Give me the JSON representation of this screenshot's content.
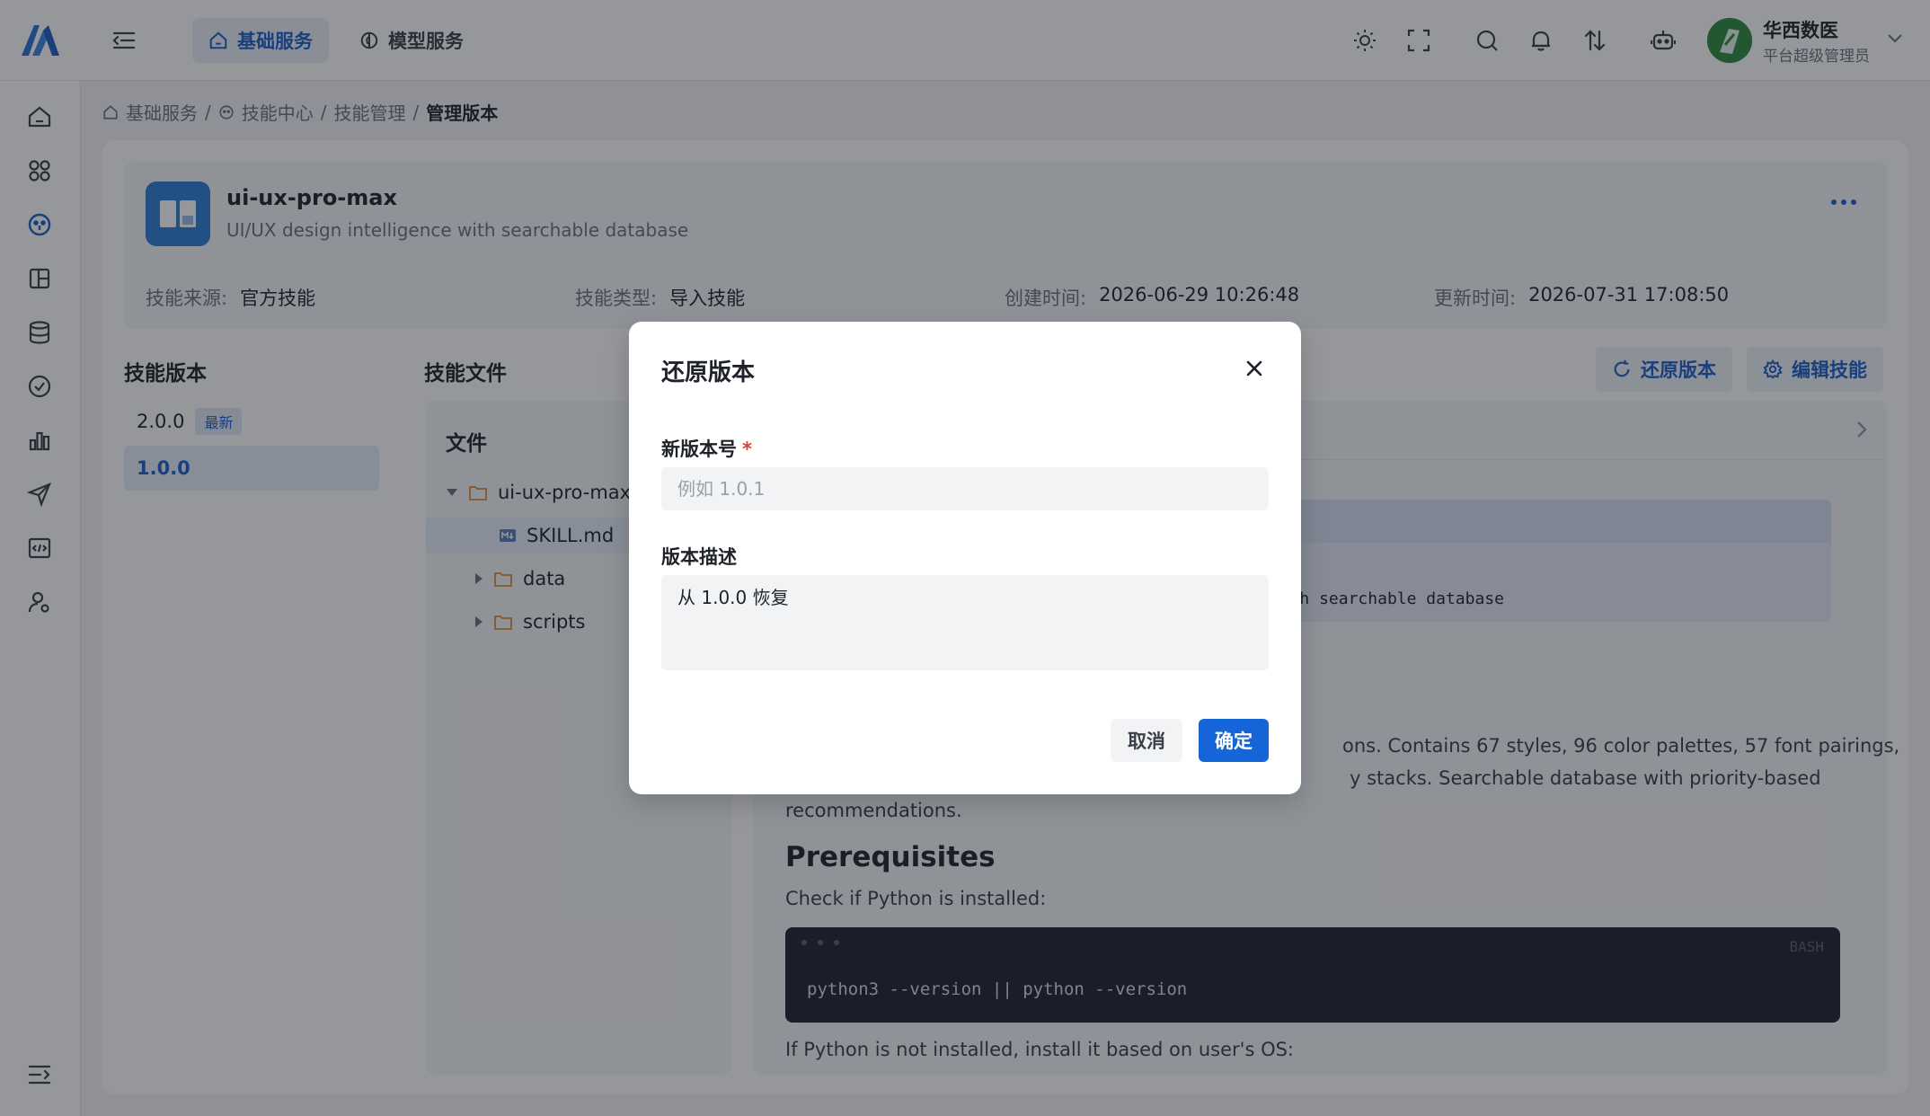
{
  "topbar": {
    "tabs": [
      {
        "label": "基础服务",
        "icon": "home-icon"
      },
      {
        "label": "模型服务",
        "icon": "brain-icon"
      }
    ],
    "user": {
      "name": "华西数医",
      "role": "平台超级管理员"
    }
  },
  "breadcrumb": {
    "items": [
      "基础服务",
      "技能中心",
      "技能管理"
    ],
    "current": "管理版本",
    "separator": "/"
  },
  "skill": {
    "name": "ui-ux-pro-max",
    "description": "UI/UX design intelligence with searchable database",
    "meta": [
      {
        "label": "技能来源:",
        "value": "官方技能"
      },
      {
        "label": "技能类型:",
        "value": "导入技能"
      },
      {
        "label": "创建时间:",
        "value": "2026-06-29 10:26:48"
      },
      {
        "label": "更新时间:",
        "value": "2026-07-31 17:08:50"
      }
    ]
  },
  "versions": {
    "title": "技能版本",
    "items": [
      {
        "version": "2.0.0",
        "badge": "最新"
      },
      {
        "version": "1.0.0",
        "badge": ""
      }
    ]
  },
  "files": {
    "section_title": "技能文件",
    "panel_title": "文件",
    "tree": [
      {
        "name": "ui-ux-pro-max",
        "type": "folder",
        "expanded": true
      },
      {
        "name": "SKILL.md",
        "type": "file"
      },
      {
        "name": "data",
        "type": "folder",
        "expanded": false
      },
      {
        "name": "scripts",
        "type": "folder",
        "expanded": false
      }
    ]
  },
  "actions": {
    "restore": "还原版本",
    "edit": "编辑技能"
  },
  "preview": {
    "frontmatter_fragment": "th searchable database",
    "paragraph_line1": "ons. Contains 67 styles, 96 color palettes, 57 font pairings,",
    "paragraph_line2": "y stacks. Searchable database with priority-based",
    "paragraph_line3": "recommendations.",
    "heading": "Prerequisites",
    "check_text": "Check if Python is installed:",
    "code_lang": "BASH",
    "code": "python3 --version || python --version",
    "after_code": "If Python is not installed, install it based on user's OS:"
  },
  "modal": {
    "title": "还原版本",
    "version_label": "新版本号",
    "required_mark": "*",
    "version_placeholder": "例如 1.0.1",
    "version_value": "",
    "desc_label": "版本描述",
    "desc_value": "从 1.0.0 恢复",
    "cancel": "取消",
    "confirm": "确定"
  },
  "colors": {
    "primary": "#1565d8",
    "overlay": "rgba(20,24,33,0.45)",
    "code_bg": "#1f2330"
  }
}
